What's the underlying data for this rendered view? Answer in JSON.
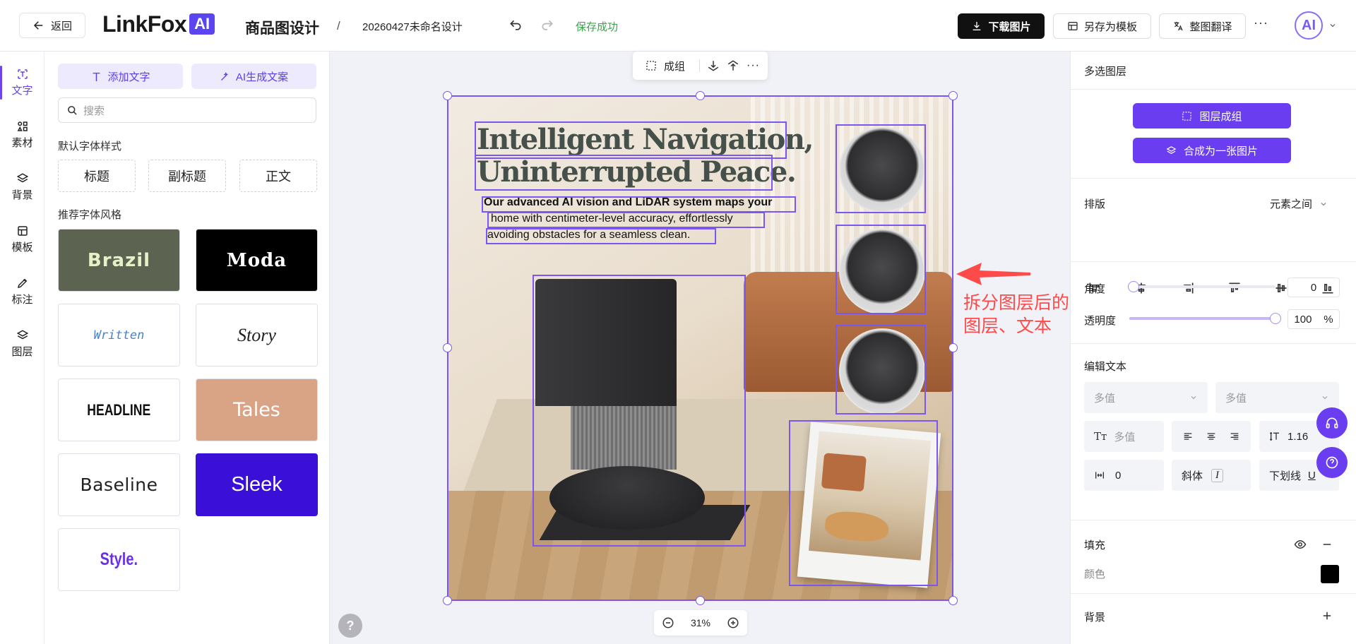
{
  "header": {
    "back_label": "返回",
    "logo_text": "LinkFox",
    "logo_badge": "AI",
    "app_title": "商品图设计",
    "separator": "/",
    "doc_title": "20260427未命名设计",
    "save_status": "保存成功",
    "download_label": "下载图片",
    "save_template_label": "另存为模板",
    "translate_label": "整图翻译",
    "more_label": "···",
    "avatar_text": "AI"
  },
  "rail": {
    "items": [
      {
        "label": "文字",
        "icon": "text-icon",
        "active": true
      },
      {
        "label": "素材",
        "icon": "material-icon"
      },
      {
        "label": "背景",
        "icon": "background-icon"
      },
      {
        "label": "模板",
        "icon": "template-icon"
      },
      {
        "label": "标注",
        "icon": "annotate-icon"
      },
      {
        "label": "图层",
        "icon": "layers-icon"
      }
    ]
  },
  "left_panel": {
    "add_text_label": "添加文字",
    "ai_copy_label": "AI生成文案",
    "search_placeholder": "搜索",
    "default_styles_title": "默认字体样式",
    "default_styles": [
      "标题",
      "副标题",
      "正文"
    ],
    "recommended_title": "推荐字体风格",
    "font_cards": [
      "Brazil",
      "Moda",
      "Written",
      "Story",
      "HEADLINE",
      "Tales",
      "Baseline",
      "Sleek",
      "Style."
    ]
  },
  "canvas": {
    "group_label": "成组",
    "headline_line1": "Intelligent Navigation,",
    "headline_line2": "Uninterrupted Peace.",
    "body_line1": "Our advanced AI vision and LiDAR system maps your",
    "body_line2": "home with centimeter-level accuracy, effortlessly",
    "body_line3": "avoiding obstacles for a seamless clean.",
    "zoom_percent": "31%",
    "help_label": "?",
    "annotation_line1": "拆分图层后的",
    "annotation_line2": "图层、文本",
    "selection_color": "#7c56f0",
    "annotation_color": "#ff4a4a"
  },
  "right_panel": {
    "title": "多选图层",
    "group_layers_label": "图层成组",
    "merge_label": "合成为一张图片",
    "layout_label": "排版",
    "layout_mode": "元素之间",
    "angle_label": "角度",
    "angle_value": "0",
    "opacity_label": "透明度",
    "opacity_value": "100",
    "opacity_unit": "%",
    "opacity_level": 1.0,
    "edit_text_label": "编辑文本",
    "font_family_value": "多值",
    "font_weight_value": "多值",
    "font_size_value": "多值",
    "line_height_value": "1.16",
    "letter_spacing_value": "0",
    "italic_label": "斜体",
    "underline_label": "下划线",
    "fill_label": "填充",
    "color_label": "颜色",
    "fill_color": "#000000",
    "background_label": "背景",
    "accent_color": "#6a3df0"
  }
}
